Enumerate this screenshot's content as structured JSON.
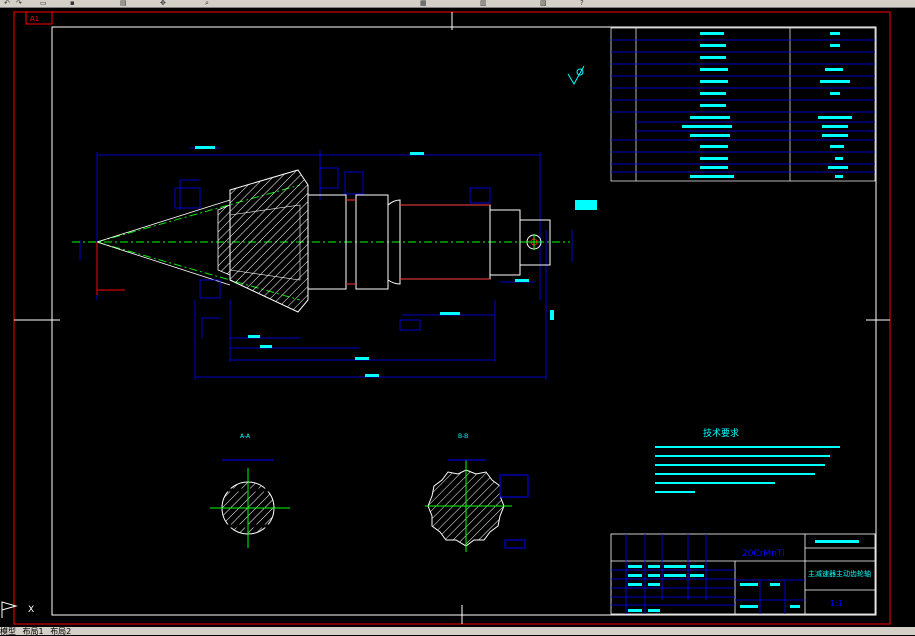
{
  "toolbar": {
    "icons": [
      "undo-icon",
      "redo-icon",
      "open-icon",
      "save-icon",
      "print-icon",
      "pan-icon",
      "zoom-icon",
      "properties-icon",
      "layer-icon",
      "match-icon",
      "help-icon"
    ]
  },
  "sheet": {
    "size_label": "A1",
    "accent_frame_color": "#ff0000",
    "cyan": "#00ffff",
    "blue": "#0000ff",
    "green": "#00ff00",
    "white": "#ffffff"
  },
  "views": {
    "section_a_label": "A-A",
    "section_b_label": "B-B"
  },
  "technical_requirements": {
    "title": "技术要求"
  },
  "title_block": {
    "drawing_title": "主减速器主动齿轮轴",
    "scale": "1:1",
    "code": "20CrMnTi"
  },
  "ucs": {
    "x_label": "X"
  },
  "tabs": {
    "model": "模型",
    "layout1": "布局1",
    "layout2": "布局2"
  }
}
